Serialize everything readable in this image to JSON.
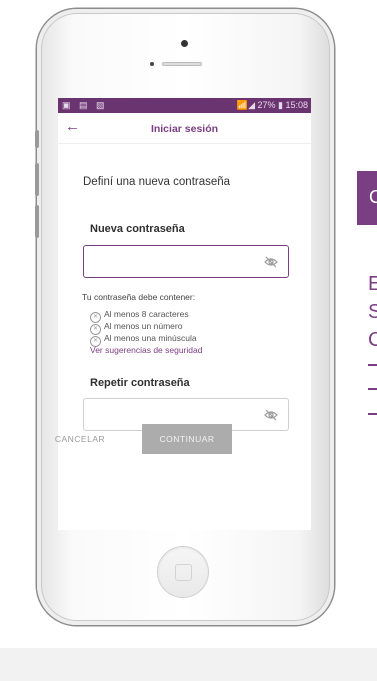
{
  "statusbar": {
    "left_icons": "▣ ▤ ▧",
    "right_info": "📶◢ 27% ▮ 15:08"
  },
  "topbar": {
    "back_icon": "←",
    "title": "Iniciar sesión"
  },
  "form": {
    "heading": "Definí una nueva contraseña",
    "new_password_label": "Nueva contraseña",
    "new_password_value": "",
    "requirements_title": "Tu contraseña debe contener:",
    "requirements": [
      "Al menos 8 caracteres",
      "Al menos un número",
      "Al menos una minúscula"
    ],
    "security_link": "Ver sugerencias de seguridad",
    "repeat_password_label": "Repetir contraseña",
    "repeat_password_value": ""
  },
  "actions": {
    "cancel": "CANCELAR",
    "continue": "CONTINUAR"
  },
  "right_panel": {
    "header_char": "C",
    "lines": [
      "E",
      "S",
      "C"
    ]
  },
  "colors": {
    "accent": "#7a3e82",
    "statusbar": "#6a3470",
    "button_disabled": "#acacac"
  }
}
